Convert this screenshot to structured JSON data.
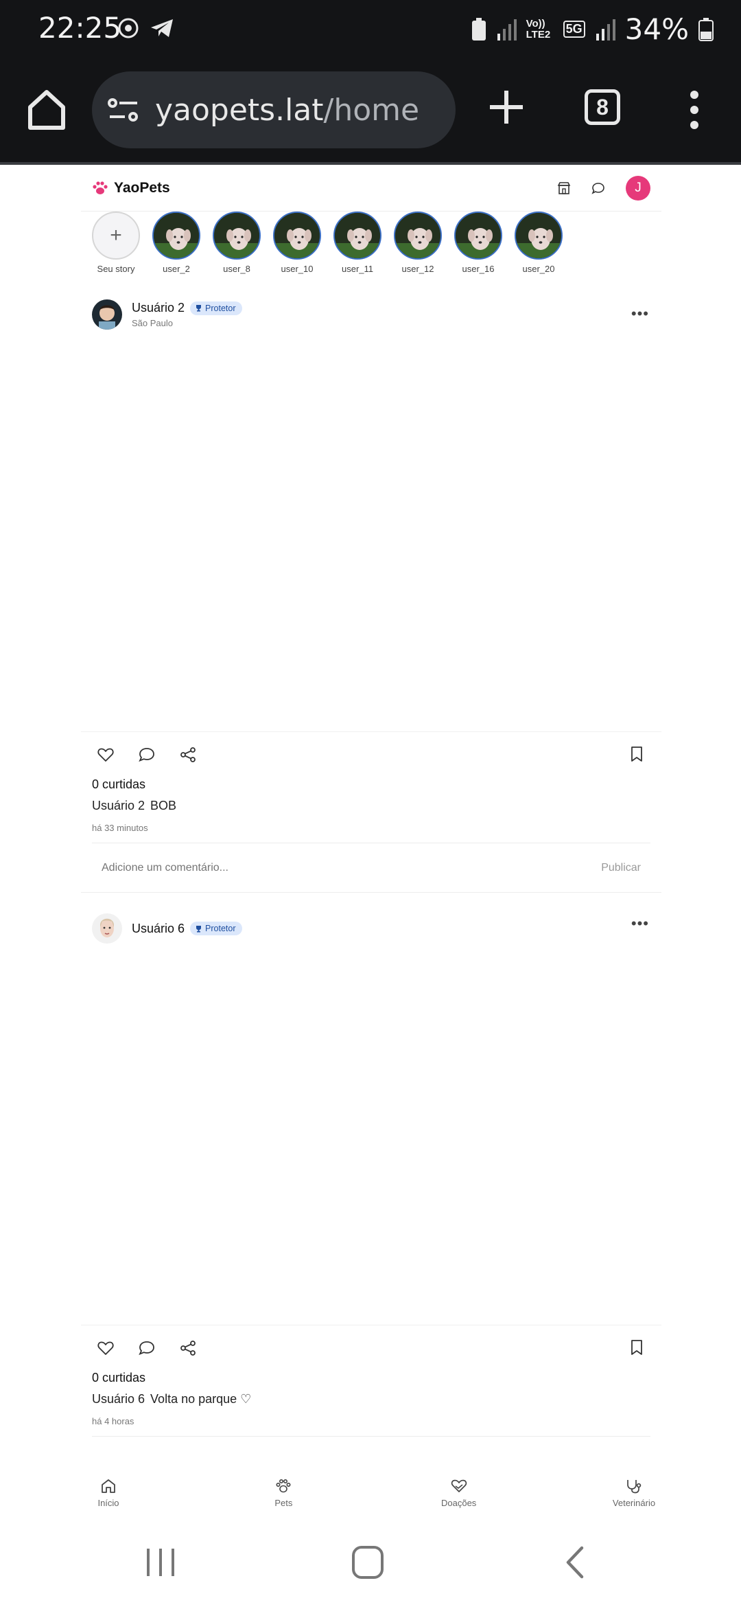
{
  "status_bar": {
    "time": "22:25",
    "battery": "34%",
    "network": "5G",
    "volte": "Vo)) LTE2"
  },
  "browser": {
    "url_domain": "yaopets.lat",
    "url_path": "/home",
    "tab_count": "8"
  },
  "header": {
    "brand": "YaoPets",
    "avatar_initial": "J",
    "accent_color": "#e6397a"
  },
  "stories": {
    "own_label": "Seu story",
    "items": [
      {
        "label": "user_2"
      },
      {
        "label": "user_8"
      },
      {
        "label": "user_10"
      },
      {
        "label": "user_11"
      },
      {
        "label": "user_12"
      },
      {
        "label": "user_16"
      },
      {
        "label": "user_20"
      }
    ]
  },
  "posts": [
    {
      "user": "Usuário 2",
      "badge": "Protetor",
      "location": "São Paulo",
      "likes": "0 curtidas",
      "caption_user": "Usuário 2",
      "caption_text": "BOB",
      "time_ago": "há 33 minutos",
      "comment_placeholder": "Adicione um comentário...",
      "publish_label": "Publicar"
    },
    {
      "user": "Usuário 6",
      "badge": "Protetor",
      "likes": "0 curtidas",
      "caption_user": "Usuário 6",
      "caption_text": "Volta no parque ♡",
      "time_ago": "há 4 horas"
    }
  ],
  "bottom_nav": {
    "items": [
      {
        "label": "Início",
        "icon": "home-icon"
      },
      {
        "label": "Pets",
        "icon": "paw-icon"
      },
      {
        "label": "Doações",
        "icon": "heart-hand-icon"
      },
      {
        "label": "Veterinário",
        "icon": "stethoscope-icon"
      }
    ]
  }
}
